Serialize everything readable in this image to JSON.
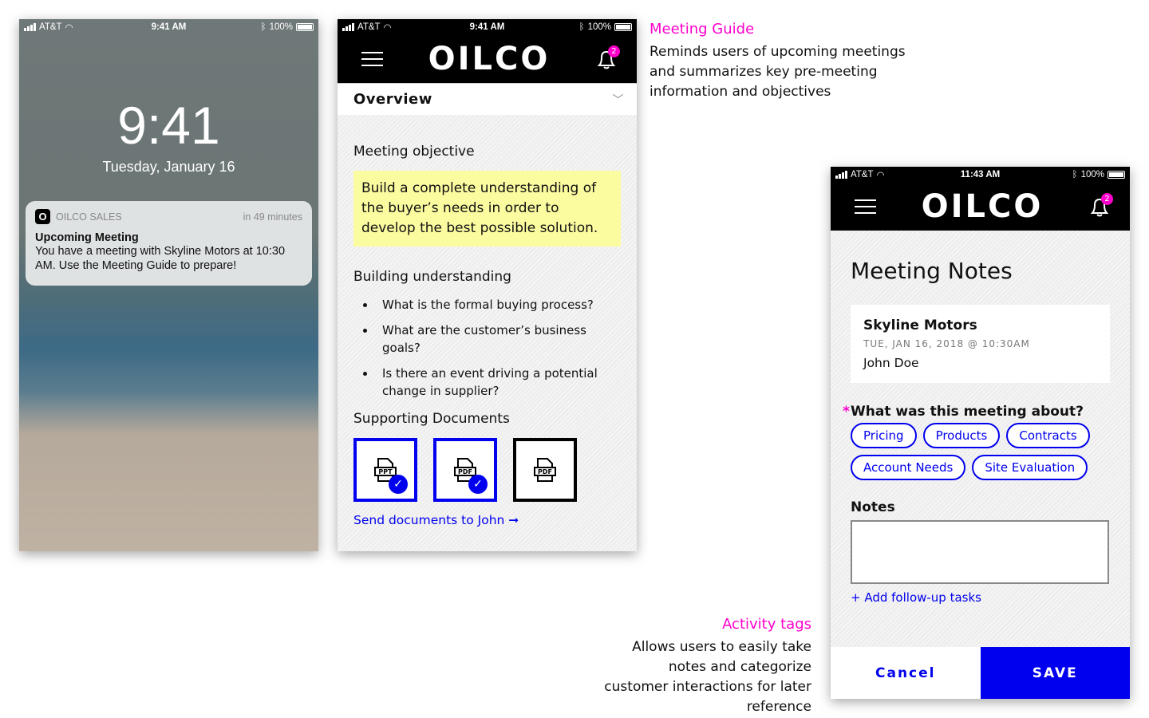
{
  "status": {
    "carrier": "AT&T",
    "battery": "100%"
  },
  "lock": {
    "status_time": "9:41 AM",
    "time": "9:41",
    "date": "Tuesday, January 16",
    "notification": {
      "app_icon": "O",
      "app": "OILCO SALES",
      "when": "in 49 minutes",
      "title": "Upcoming Meeting",
      "body": "You have a meeting with Skyline Motors at 10:30 AM. Use the Meeting Guide to prepare!"
    }
  },
  "guide": {
    "status_time": "9:41 AM",
    "logo": "OILCO",
    "badge": "2",
    "dropdown": "Overview",
    "objective_heading": "Meeting objective",
    "objective": "Build a complete understanding of the buyer’s needs in order to develop the best possible solution.",
    "understanding_heading": "Building understanding",
    "questions": [
      "What is the formal buying process?",
      "What are the customer’s business goals?",
      "Is there an event driving a potential change in supplier?"
    ],
    "docs_heading": "Supporting Documents",
    "docs": [
      {
        "type": "PPT",
        "selected": true
      },
      {
        "type": "PDF",
        "selected": true
      },
      {
        "type": "PDF",
        "selected": false
      }
    ],
    "send_link": "Send documents to John ➞"
  },
  "notes": {
    "status_time": "11:43 AM",
    "logo": "OILCO",
    "badge": "2",
    "title": "Meeting Notes",
    "card": {
      "company": "Skyline Motors",
      "datetime": "TUE, JAN 16, 2018 @ 10:30AM",
      "contact": "John Doe"
    },
    "question_required": "*",
    "question": "What was this meeting about?",
    "tags": [
      "Pricing",
      "Products",
      "Contracts",
      "Account Needs",
      "Site Evaluation"
    ],
    "notes_label": "Notes",
    "notes_value": "",
    "add_tasks": "+ Add follow-up tasks",
    "cancel": "Cancel",
    "save": "SAVE"
  },
  "annotations": {
    "guide_title": "Meeting Guide",
    "guide_text": "Reminds users of upcoming meetings and summarizes key pre-meeting information and objectives",
    "tags_title": "Activity tags",
    "tags_text": "Allows users to easily take notes and categorize customer interactions for later reference"
  },
  "colors": {
    "accent": "#0000ee",
    "badge": "#ff00cc",
    "highlight": "#fbfba0"
  }
}
